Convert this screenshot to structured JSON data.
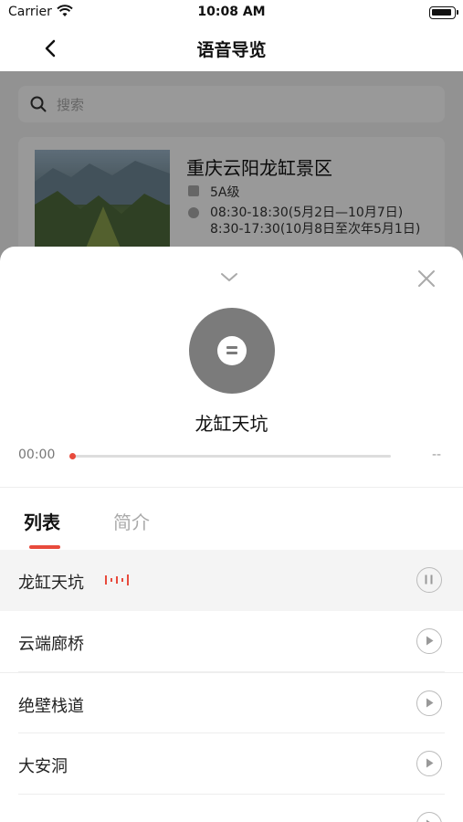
{
  "status_bar": {
    "carrier": "Carrier",
    "time": "10:08 AM"
  },
  "nav": {
    "title": "语音导览",
    "back_icon": "chevron-left-icon"
  },
  "background": {
    "search_placeholder": "搜索",
    "scenic": {
      "name": "重庆云阳龙缸景区",
      "level": "5A级",
      "hours": "08:30-18:30(5月2日—10月7日)\n8:30-17:30(10月8日至次年5月1日)"
    }
  },
  "player": {
    "collapse_icon": "chevron-down-icon",
    "close_icon": "close-icon",
    "title": "龙缸天坑",
    "current_time": "00:00",
    "total_time": "--",
    "progress": 0,
    "accent_color": "#e84a3c"
  },
  "tabs": [
    {
      "label": "列表",
      "active": true
    },
    {
      "label": "简介",
      "active": false
    }
  ],
  "tracks": [
    {
      "label": "龙缸天坑",
      "state": "playing",
      "icon": "pause-icon"
    },
    {
      "label": "云端廊桥",
      "state": "idle",
      "icon": "play-icon"
    },
    {
      "label": "绝壁栈道",
      "state": "idle",
      "icon": "play-icon"
    },
    {
      "label": "大安洞",
      "state": "idle",
      "icon": "play-icon"
    },
    {
      "label": "",
      "state": "idle",
      "icon": "play-icon"
    }
  ]
}
